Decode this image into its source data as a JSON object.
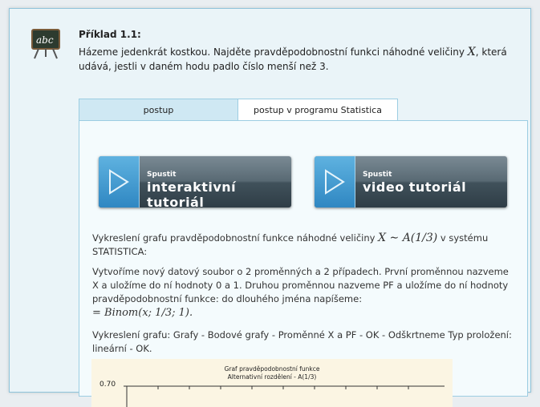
{
  "example": {
    "title": "Příklad 1.1:",
    "text_part1": "Házeme jedenkrát kostkou. Najděte pravděpodobnostní funkci náhodné veličiny ",
    "var": "X",
    "text_part2": ", která udává, jestli v daném hodu padlo číslo menší než 3."
  },
  "tabs": [
    {
      "label": "postup"
    },
    {
      "label": "postup v programu Statistica"
    }
  ],
  "buttons": {
    "interactive": {
      "line1": "Spustit",
      "line2": "interaktivní tutoriál"
    },
    "video": {
      "line1": "Spustit",
      "line2": "video tutoriál"
    }
  },
  "paragraphs": {
    "p1_a": "Vykreslení grafu pravděpodobnostní funkce náhodné veličiny ",
    "p1_math": "X ∼ A(1/3)",
    "p1_b": " v systému STATISTICA:",
    "p2": "Vytvoříme nový datový soubor o 2 proměnných a 2 případech. První proměnnou nazveme X a uložíme do ní hodnoty 0 a 1. Druhou proměnnou nazveme PF a uložíme do ní hodnoty pravděpodobnostní funkce: do dlouhého jména napíšeme:",
    "p2_formula": "= Binom(x; 1/3; 1).",
    "p3": "Vykreslení grafu: Grafy - Bodové grafy - Proměnné X a PF - OK - Odškrtneme Typ proložení: lineární - OK."
  },
  "chart": {
    "title": "Graf pravděpodobnostní funkce",
    "subtitle": "Alternativní rozdělení - A(1/3)",
    "ytick_top": "0.70"
  }
}
